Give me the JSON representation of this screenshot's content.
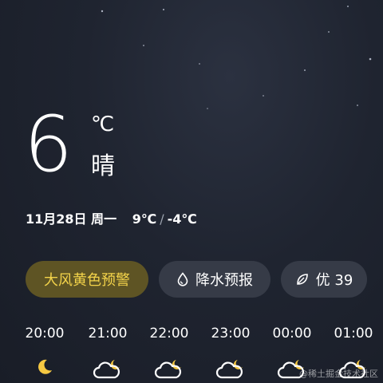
{
  "current": {
    "temperature": "6",
    "unit": "℃",
    "condition": "晴"
  },
  "date_line": {
    "date": "11月28日",
    "weekday": "周一",
    "high": "9℃",
    "separator": "/",
    "low": "-4℃"
  },
  "chips": {
    "alert": {
      "label": "大风黄色预警",
      "color": "#f3d34a",
      "background": "#5e5424"
    },
    "precipitation": {
      "label": "降水预报",
      "icon": "droplet-icon"
    },
    "aqi": {
      "label": "优 39",
      "icon": "leaf-icon"
    }
  },
  "hourly": [
    {
      "time": "20:00",
      "icon": "moon-icon"
    },
    {
      "time": "21:00",
      "icon": "cloudy-night-icon"
    },
    {
      "time": "22:00",
      "icon": "cloudy-night-icon"
    },
    {
      "time": "23:00",
      "icon": "cloudy-night-icon"
    },
    {
      "time": "00:00",
      "icon": "cloudy-night-icon"
    },
    {
      "time": "01:00",
      "icon": "cloudy-night-icon"
    }
  ],
  "watermark": "@稀土掘金技术社区"
}
